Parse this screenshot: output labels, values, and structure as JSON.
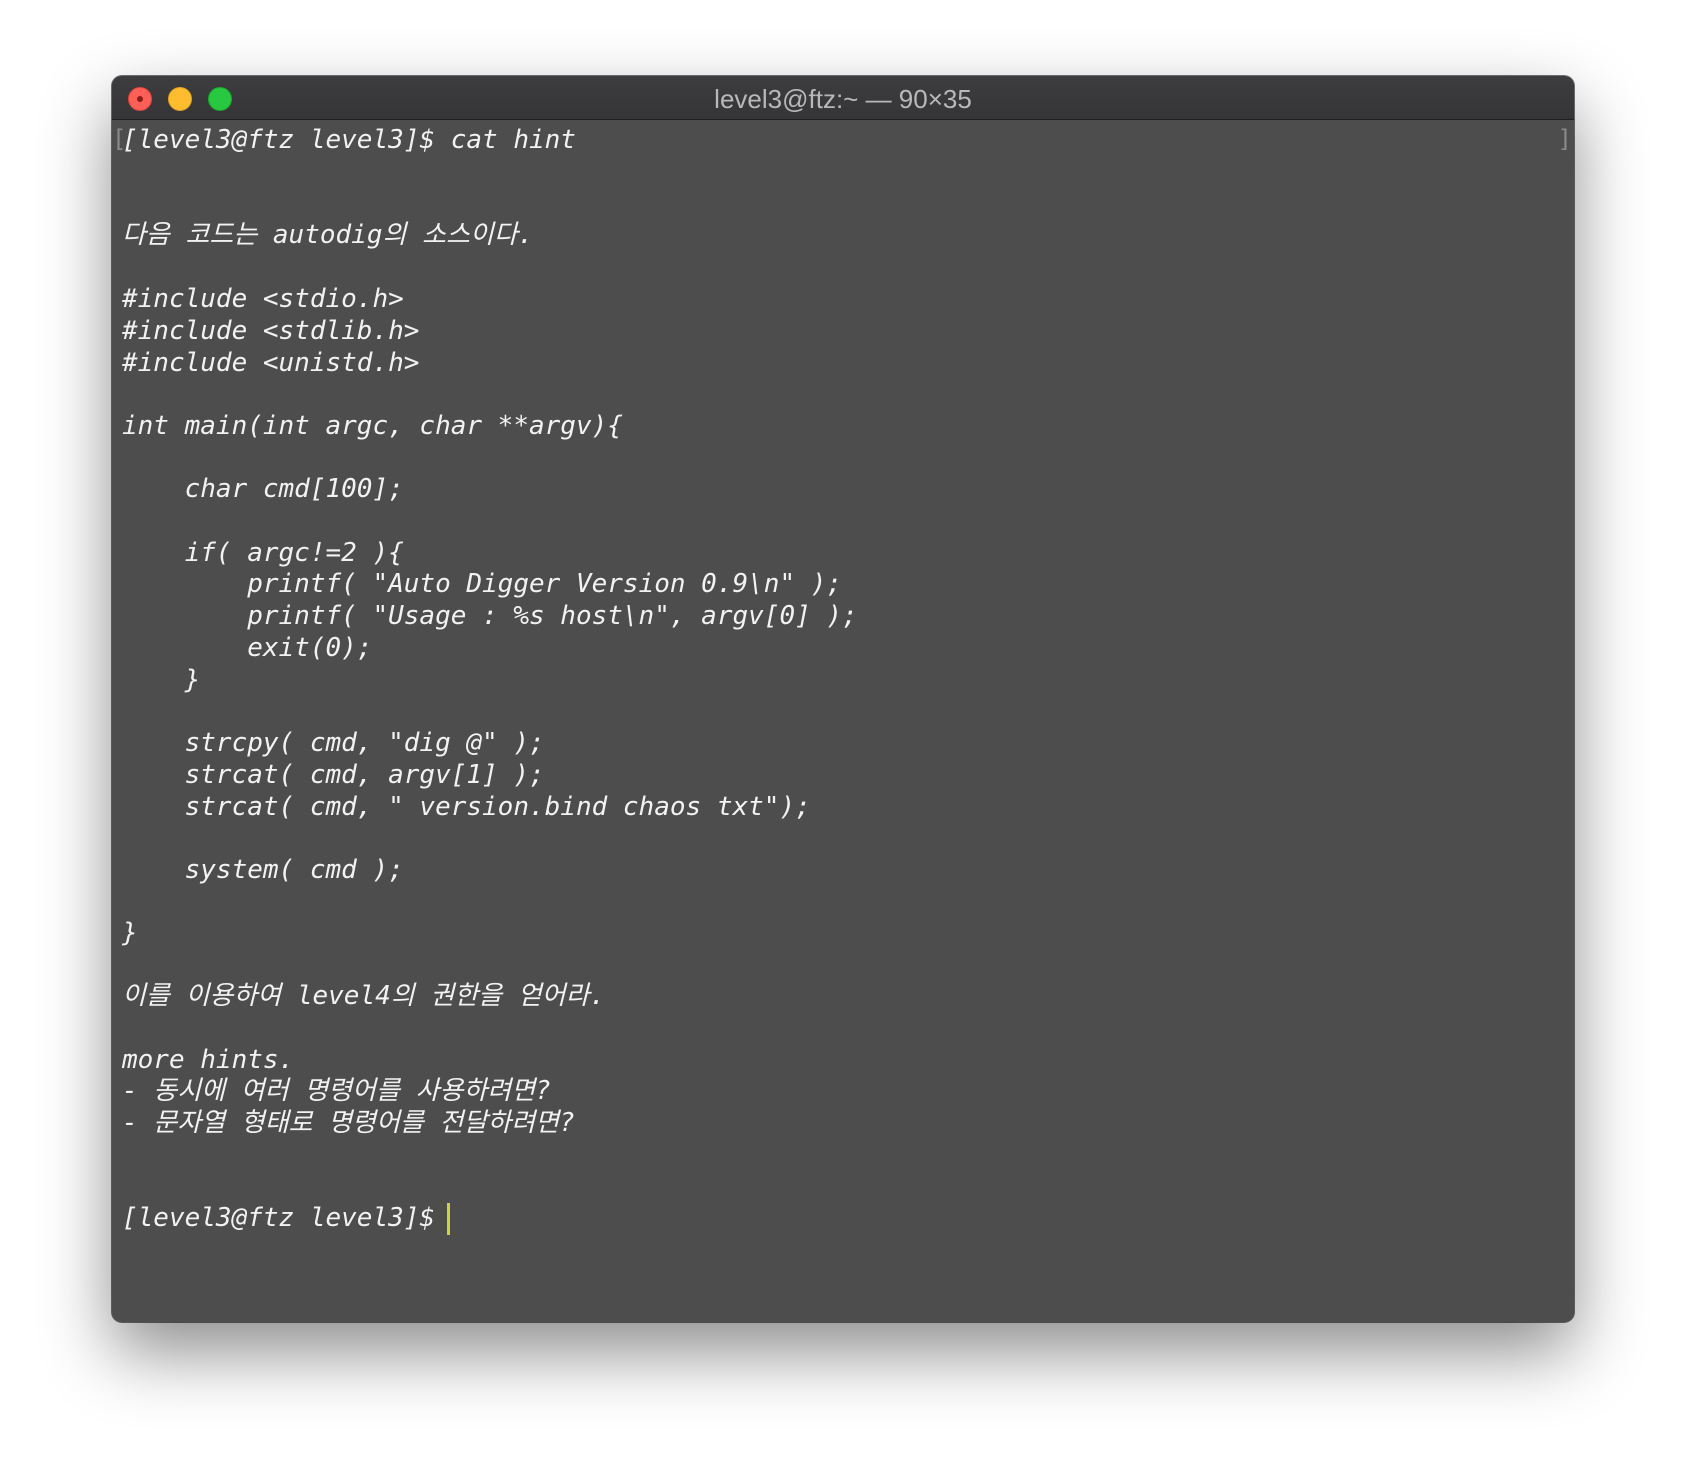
{
  "window": {
    "title": "level3@ftz:~ — 90×35"
  },
  "terminal": {
    "lines": [
      "[level3@ftz level3]$ cat hint",
      "다음 코드는 autodig의 소스이다.",
      "#include <stdio.h>",
      "#include <stdlib.h>",
      "#include <unistd.h>",
      "int main(int argc, char **argv){",
      "    char cmd[100];",
      "    if( argc!=2 ){",
      "        printf( \"Auto Digger Version 0.9\\n\" );",
      "        printf( \"Usage : %s host\\n\", argv[0] );",
      "        exit(0);",
      "    }",
      "    strcpy( cmd, \"dig @\" );",
      "    strcat( cmd, argv[1] );",
      "    strcat( cmd, \" version.bind chaos txt\");",
      "    system( cmd );",
      "}",
      "이를 이용하여 level4의 권한을 얻어라.",
      "more hints.",
      "- 동시에 여러 명령어를 사용하려면?",
      "- 문자열 형태로 명령어를 전달하려면?",
      "[level3@ftz level3]$"
    ]
  }
}
